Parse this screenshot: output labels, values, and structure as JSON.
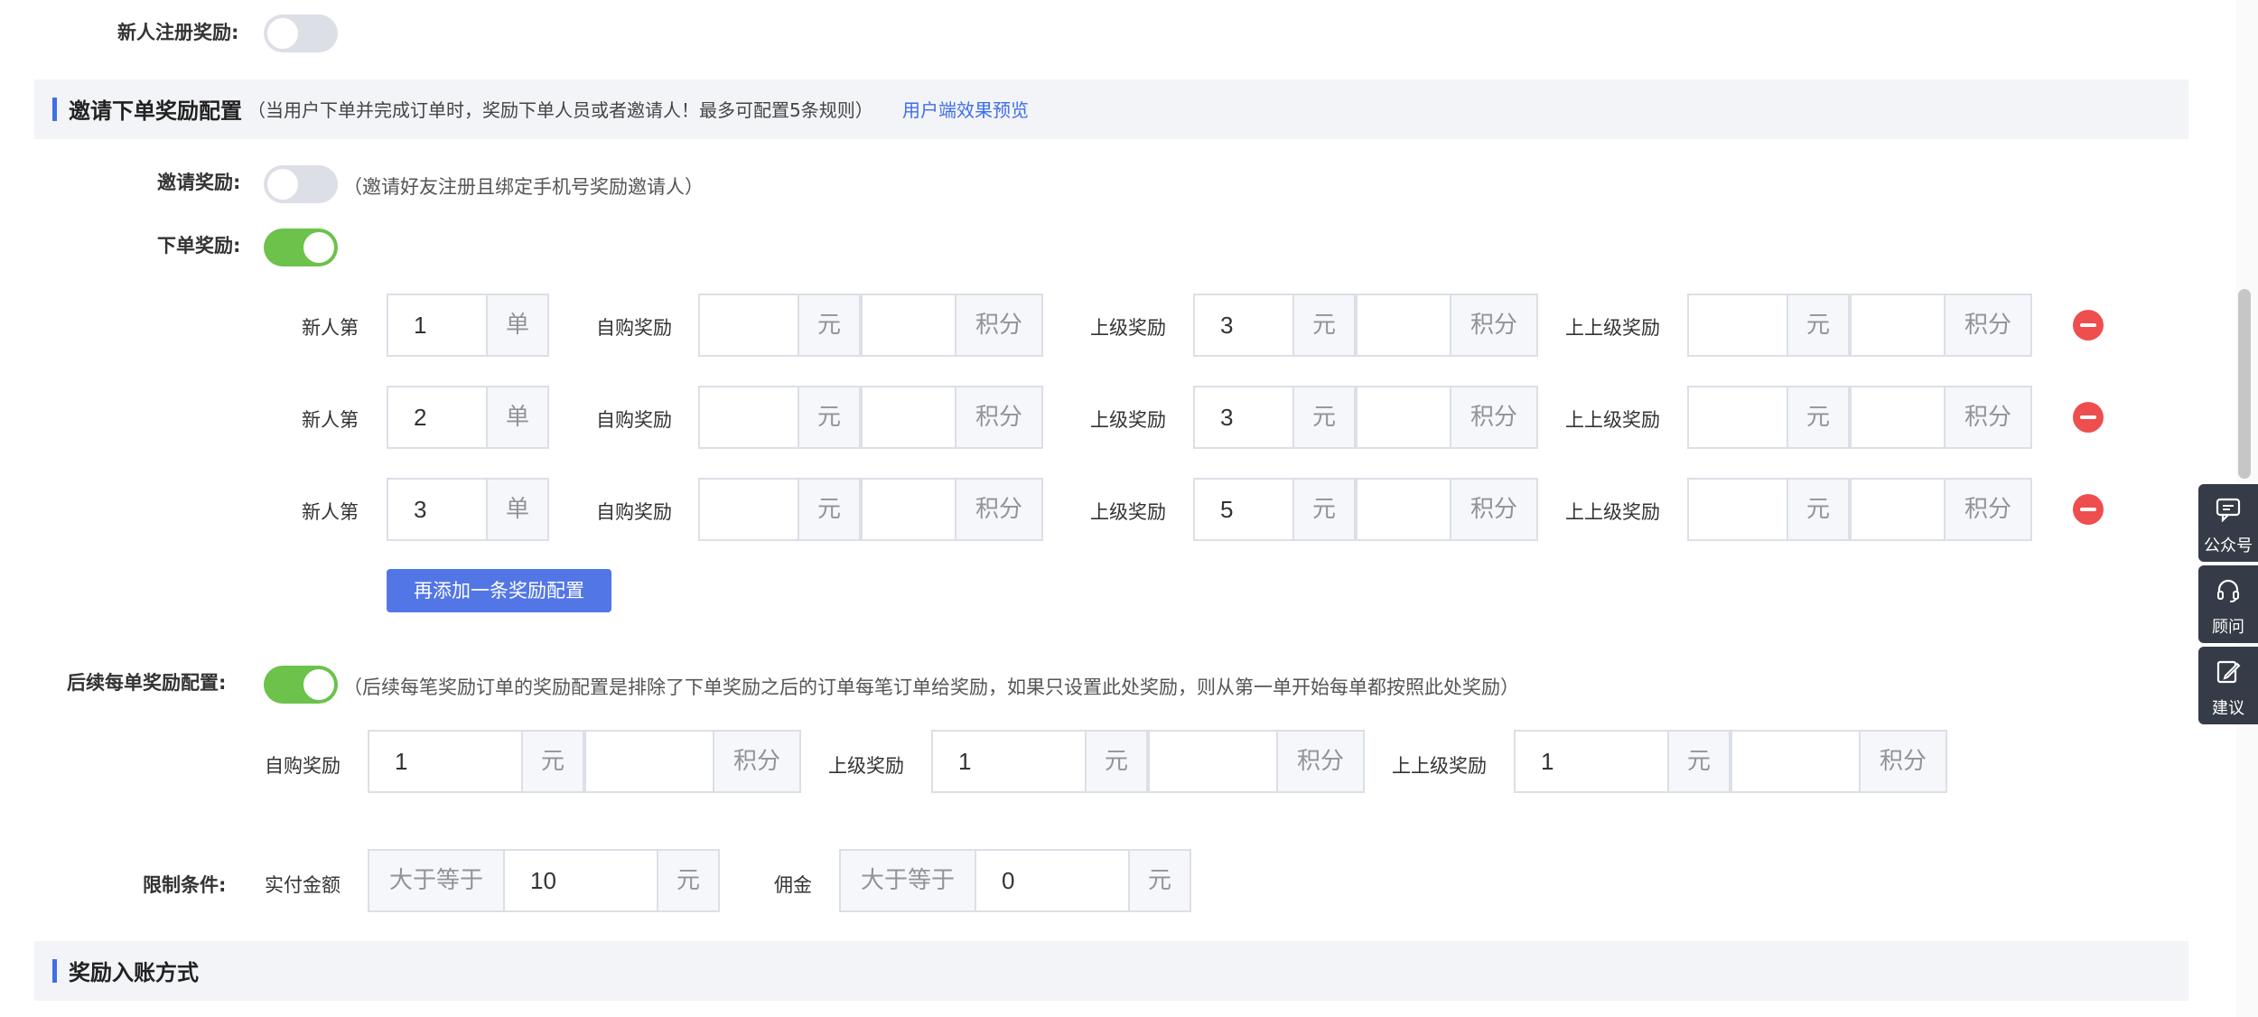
{
  "register_reward": {
    "label": "新人注册奖励:",
    "enabled": false
  },
  "invite_section": {
    "title": "邀请下单奖励配置",
    "note": "（当用户下单并完成订单时，奖励下单人员或者邀请人！最多可配置5条规则）",
    "preview_link": "用户端效果预览"
  },
  "invite_reward": {
    "label": "邀请奖励:",
    "enabled": false,
    "hint": "（邀请好友注册且绑定手机号奖励邀请人）"
  },
  "order_reward": {
    "label": "下单奖励:",
    "enabled": true
  },
  "tiers": [
    {
      "prefix": "新人第",
      "nth": "1",
      "nth_unit": "单",
      "self_label": "自购奖励",
      "self_yuan": "",
      "yuan_unit": "元",
      "self_points": "",
      "points_unit": "积分",
      "parent_label": "上级奖励",
      "parent_yuan": "3",
      "parent_points": "",
      "grand_label": "上上级奖励",
      "grand_yuan": "",
      "grand_points": ""
    },
    {
      "prefix": "新人第",
      "nth": "2",
      "nth_unit": "单",
      "self_label": "自购奖励",
      "self_yuan": "",
      "yuan_unit": "元",
      "self_points": "",
      "points_unit": "积分",
      "parent_label": "上级奖励",
      "parent_yuan": "3",
      "parent_points": "",
      "grand_label": "上上级奖励",
      "grand_yuan": "",
      "grand_points": ""
    },
    {
      "prefix": "新人第",
      "nth": "3",
      "nth_unit": "单",
      "self_label": "自购奖励",
      "self_yuan": "",
      "yuan_unit": "元",
      "self_points": "",
      "points_unit": "积分",
      "parent_label": "上级奖励",
      "parent_yuan": "5",
      "parent_points": "",
      "grand_label": "上上级奖励",
      "grand_yuan": "",
      "grand_points": ""
    }
  ],
  "add_button": "再添加一条奖励配置",
  "subsequent": {
    "label": "后续每单奖励配置:",
    "enabled": true,
    "hint": "（后续每笔奖励订单的奖励配置是排除了下单奖励之后的订单每笔订单给奖励，如果只设置此处奖励，则从第一单开始每单都按照此处奖励）",
    "self_label": "自购奖励",
    "self_yuan": "1",
    "self_points": "",
    "parent_label": "上级奖励",
    "parent_yuan": "1",
    "parent_points": "",
    "grand_label": "上上级奖励",
    "grand_yuan": "1",
    "grand_points": "",
    "yuan_unit": "元",
    "points_unit": "积分"
  },
  "limits": {
    "label": "限制条件:",
    "paid_label": "实付金额",
    "paid_op": "大于等于",
    "paid_value": "10",
    "paid_unit": "元",
    "commission_label": "佣金",
    "commission_op": "大于等于",
    "commission_value": "0",
    "commission_unit": "元"
  },
  "settle_section": {
    "title": "奖励入账方式"
  },
  "float_bar": [
    {
      "icon": "chat-icon",
      "label": "公众号"
    },
    {
      "icon": "headset-icon",
      "label": "顾问"
    },
    {
      "icon": "edit-icon",
      "label": "建议"
    }
  ],
  "colors": {
    "accent": "#3f6ee7",
    "button": "#5376e6",
    "toggle_on": "#6cc24a",
    "remove": "#ee4e4e",
    "float_bar": "#363b48"
  }
}
